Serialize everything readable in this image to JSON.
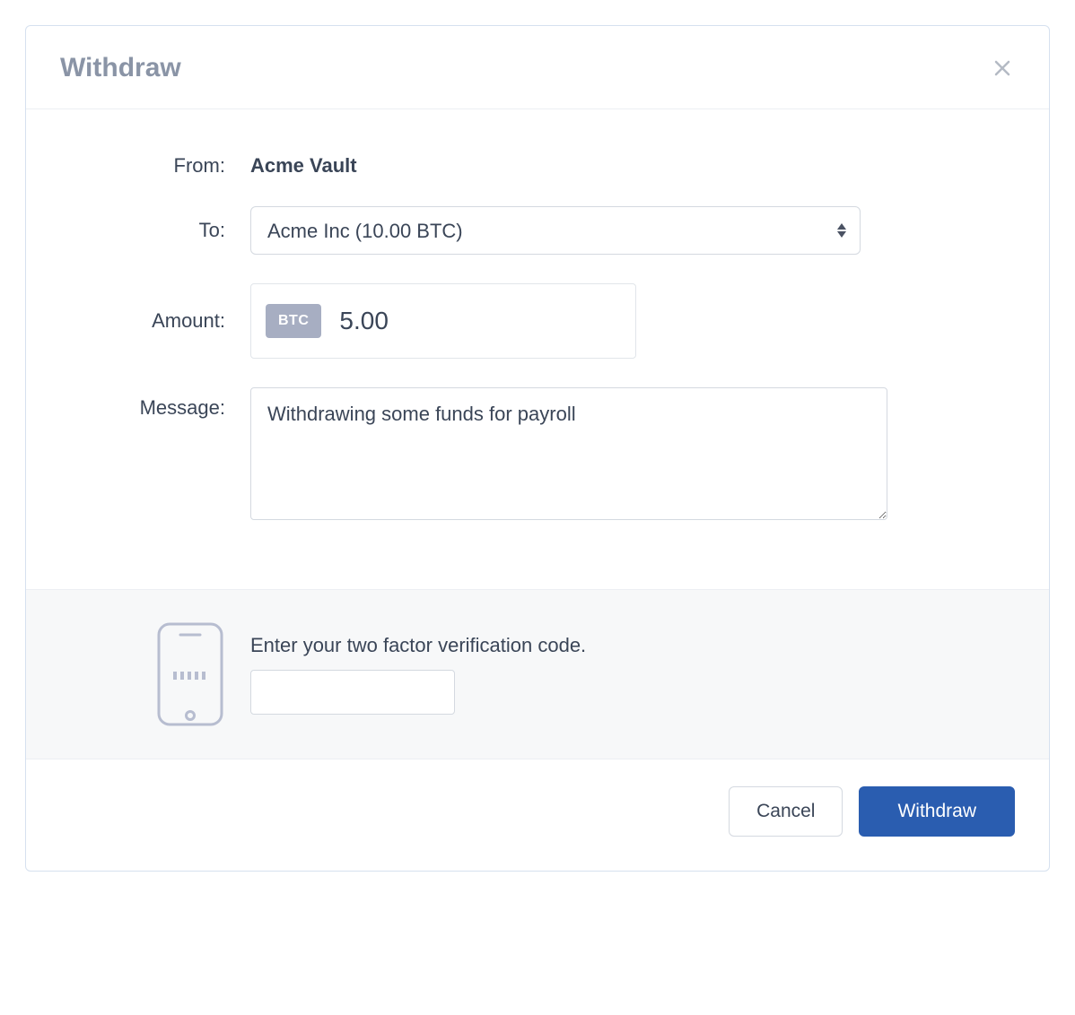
{
  "modal": {
    "title": "Withdraw"
  },
  "form": {
    "from_label": "From:",
    "from_value": "Acme Vault",
    "to_label": "To:",
    "to_selected": "Acme Inc (10.00 BTC)",
    "amount_label": "Amount:",
    "currency_badge": "BTC",
    "amount_value": "5.00",
    "message_label": "Message:",
    "message_value": "Withdrawing some funds for payroll"
  },
  "twofa": {
    "label": "Enter your two factor verification code.",
    "value": ""
  },
  "footer": {
    "cancel_label": "Cancel",
    "submit_label": "Withdraw"
  }
}
